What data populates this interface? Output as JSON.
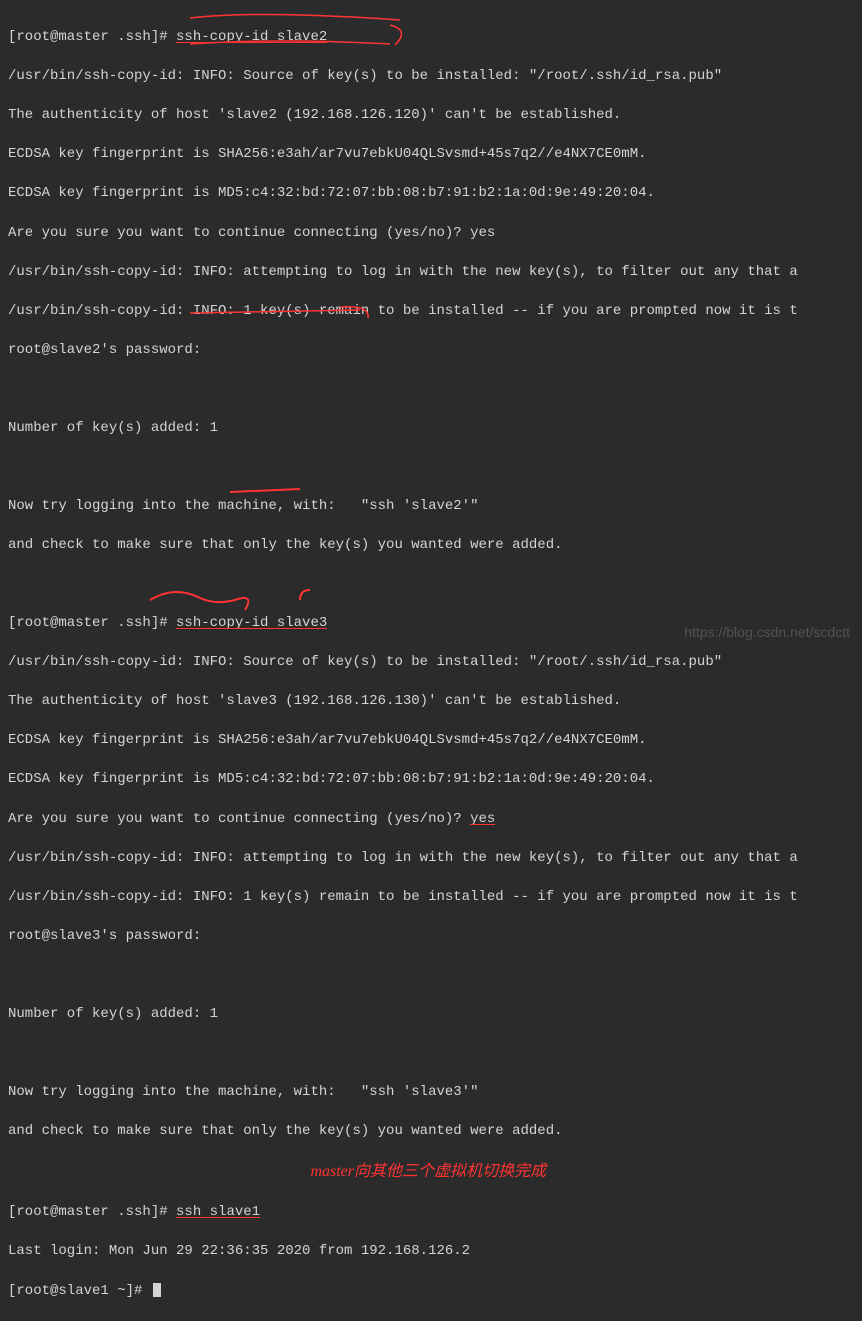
{
  "lines": {
    "l01a": "[root@master .ssh]# ",
    "l01b": "ssh-copy-id slave2",
    "l02": "/usr/bin/ssh-copy-id: INFO: Source of key(s) to be installed: \"/root/.ssh/id_rsa.pub\"",
    "l03": "The authenticity of host 'slave2 (192.168.126.120)' can't be established.",
    "l04": "ECDSA key fingerprint is SHA256:e3ah/ar7vu7ebkU04QLSvsmd+45s7q2//e4NX7CE0mM.",
    "l05": "ECDSA key fingerprint is MD5:c4:32:bd:72:07:bb:08:b7:91:b2:1a:0d:9e:49:20:04.",
    "l06": "Are you sure you want to continue connecting (yes/no)? yes",
    "l07": "/usr/bin/ssh-copy-id: INFO: attempting to log in with the new key(s), to filter out any that a",
    "l08": "/usr/bin/ssh-copy-id: INFO: 1 key(s) remain to be installed -- if you are prompted now it is t",
    "l09": "root@slave2's password:",
    "l10": "",
    "l11": "Number of key(s) added: 1",
    "l12": "",
    "l13": "Now try logging into the machine, with:   \"ssh 'slave2'\"",
    "l14": "and check to make sure that only the key(s) you wanted were added.",
    "l15": "",
    "l16a": "[root@master .ssh]# ",
    "l16b": "ssh-copy-id slave3",
    "l17": "/usr/bin/ssh-copy-id: INFO: Source of key(s) to be installed: \"/root/.ssh/id_rsa.pub\"",
    "l18": "The authenticity of host 'slave3 (192.168.126.130)' can't be established.",
    "l19": "ECDSA key fingerprint is SHA256:e3ah/ar7vu7ebkU04QLSvsmd+45s7q2//e4NX7CE0mM.",
    "l20": "ECDSA key fingerprint is MD5:c4:32:bd:72:07:bb:08:b7:91:b2:1a:0d:9e:49:20:04.",
    "l21a": "Are you sure you want to continue connecting (yes/no)? ",
    "l21b": "yes",
    "l22": "/usr/bin/ssh-copy-id: INFO: attempting to log in with the new key(s), to filter out any that a",
    "l23": "/usr/bin/ssh-copy-id: INFO: 1 key(s) remain to be installed -- if you are prompted now it is t",
    "l24": "root@slave3's password:",
    "l25": "",
    "l26": "Number of key(s) added: 1",
    "l27": "",
    "l28": "Now try logging into the machine, with:   \"ssh 'slave3'\"",
    "l29": "and check to make sure that only the key(s) you wanted were added.",
    "l30": "",
    "l31a": "[root@master .ssh]# ",
    "l31b": "ssh slave1",
    "l32": "Last login: Mon Jun 29 22:36:35 2020 from 192.168.126.2",
    "l33": "[root@slave1 ~]# "
  },
  "annotation": "master向其他三个虚拟机切换完成",
  "watermark": "https://blog.csdn.net/scdctt"
}
